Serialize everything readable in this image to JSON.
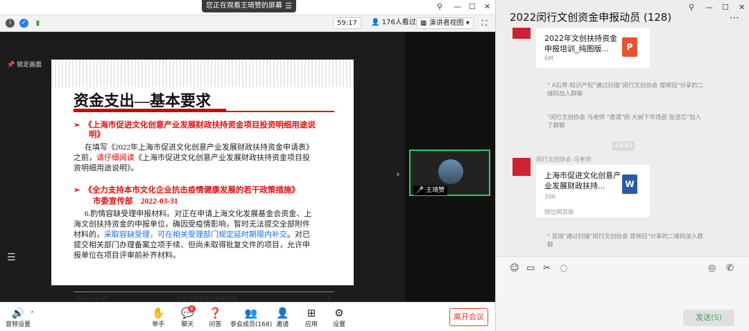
{
  "meeting": {
    "share_banner": "您正在观看王琦赞的屏幕",
    "timer": "59:17",
    "attendees": "176人看过",
    "view_mode": "演讲者视图",
    "lock_label": "锁定画面",
    "speaker_name": "王琦赞",
    "leave_label": "离开会议",
    "toolbar": {
      "audio": "音频设置",
      "raise_hand": "举手",
      "chat": "聊天",
      "chat_badge": "6",
      "qa": "问答",
      "participants": "参会成员(168)",
      "invite": "邀请",
      "apps": "应用",
      "settings": "设置"
    }
  },
  "slide": {
    "title": "资金支出—基本要求",
    "bullet1": "《上海市促进文化创意产业发展财政扶持资金项目投资明细用途说明》",
    "bullet1_a": "《上海市促进文化创意产业发展财政扶持资金项目投资明细用途说",
    "bullet1_b": "明》",
    "para1_a": "在填写《2022年上海市促进文化创意产业发展财政扶持资金申请表》",
    "para1_b_prefix": "之前，",
    "para1_b_red": "请仔细阅读",
    "para1_b_suffix": "《上海市促进文化创意产业发展财政扶持资金项目投",
    "para1_c": "资明细用途说明》。",
    "bullet2": "《全力支持本市文化企业抗击疫情健康发展的若干政策措施》",
    "bullet2_sub": "市委宣传部　2022-03-31",
    "para2_a": "6.酌情容缺受理申报材料。对正在申请上海文化发展基金会资金、上",
    "para2_b": "海文创扶持资金的申报单位，确因受疫情影响，暂时无法提交全部附件",
    "para2_c_prefix": "材料的，",
    "para2_c_blue": "采取容缺受理，可在相关受理部门规定延时期限内补交",
    "para2_c_suffix": "。对已",
    "para2_d": "提交相关部门办理备案立项手续、但尚未取得批复文件的项目，允许申",
    "para2_e": "报单位在项目评审前补齐材料。",
    "footer_date": "2022-04-08",
    "footer_org": "上海王琦赞会计师事务所",
    "footer_page": "6"
  },
  "chat": {
    "title": "2022闵行文创资金申报动员 (128)",
    "file1_title": "2022年文创扶持资金申报培训_纯图版...",
    "file1_size": "6M",
    "file1_type": "P",
    "sys1": "\" A石秀-知识产权\"通过扫描\"闵行文创协会 胥晓钰\"分享的二维码加入群聊",
    "sys2": "\"闵行文创协会 马老师 \"邀请\"闵 大树下市场部 张语芯\"加入了群聊",
    "time": "14:42",
    "sender": "闵行文创协会 马老师",
    "file2_title": "上海市促进文化创意产业发展财政扶持...",
    "file2_size": "39K",
    "file2_type": "W",
    "file2_source": "微信网页版",
    "sys3": "\" 吴瑞\"通过扫描\"闵行文创协会 胥晓钰\"分享的二维码加入群聊",
    "send_label": "发送(S)"
  }
}
